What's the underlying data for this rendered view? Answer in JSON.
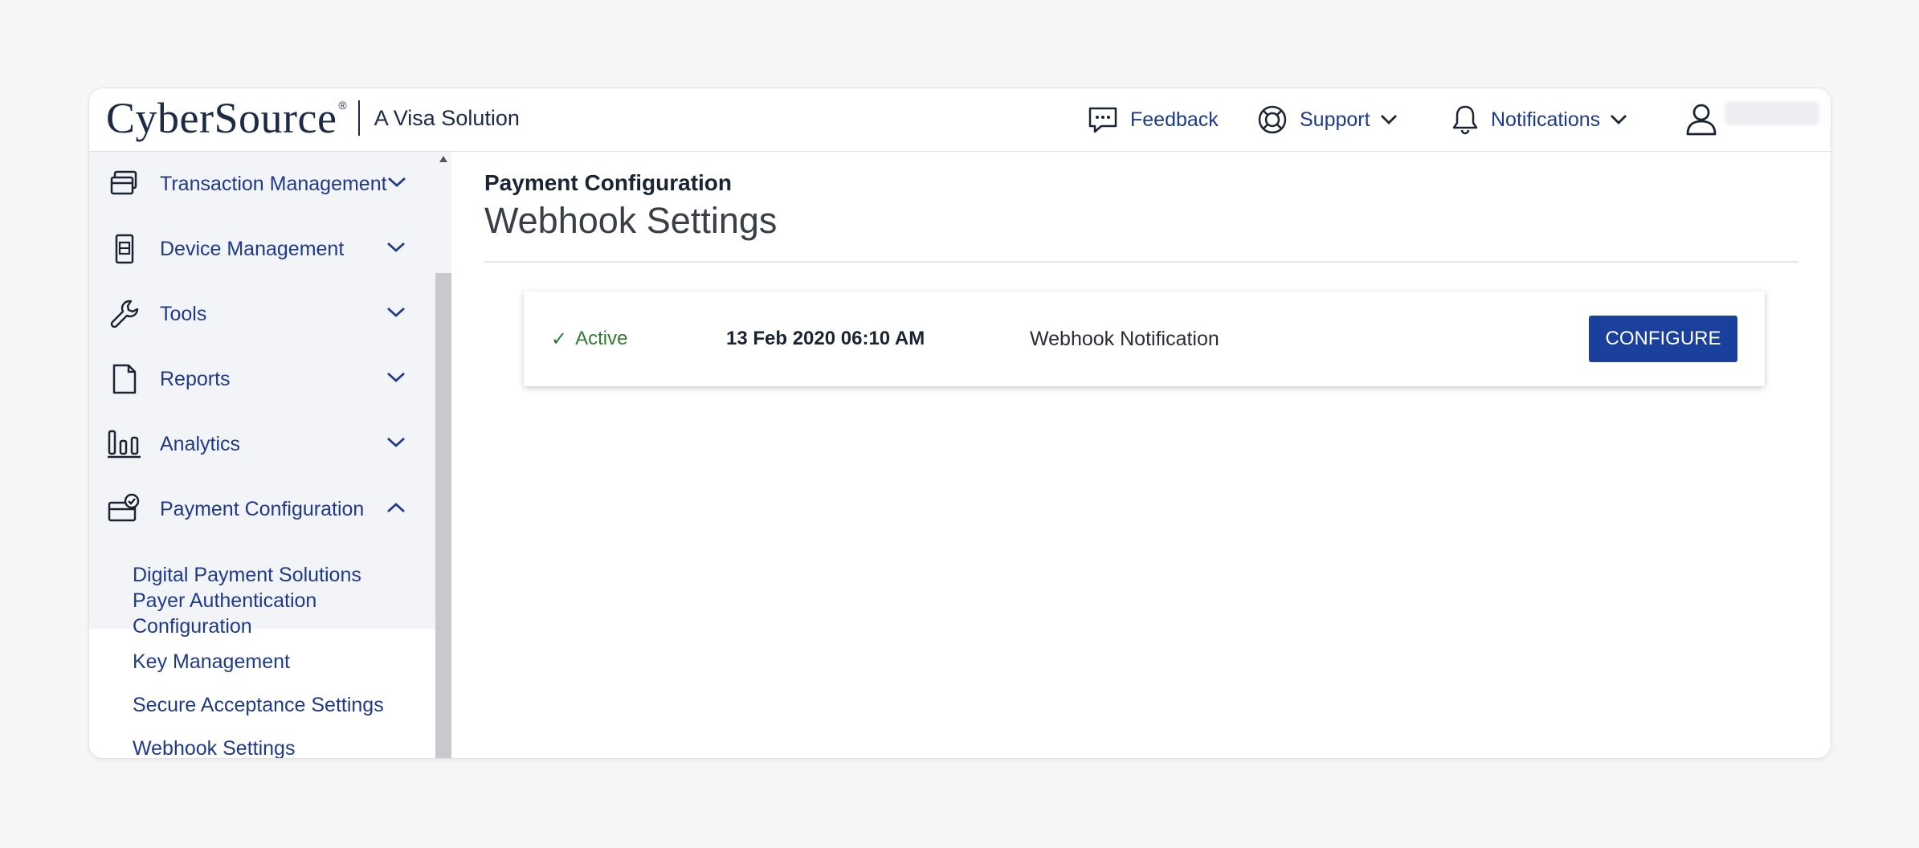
{
  "header": {
    "logo_text": "CyberSource",
    "logo_reg": "®",
    "logo_sub": "A Visa Solution",
    "feedback_label": "Feedback",
    "support_label": "Support",
    "notifications_label": "Notifications"
  },
  "sidebar": {
    "items": [
      {
        "label": "Transaction Management",
        "icon": "card-stack-icon",
        "expanded": false
      },
      {
        "label": "Device Management",
        "icon": "device-icon",
        "expanded": false
      },
      {
        "label": "Tools",
        "icon": "wrench-icon",
        "expanded": false
      },
      {
        "label": "Reports",
        "icon": "document-icon",
        "expanded": false
      },
      {
        "label": "Analytics",
        "icon": "bar-chart-icon",
        "expanded": false
      },
      {
        "label": "Payment Configuration",
        "icon": "card-check-icon",
        "expanded": true
      }
    ],
    "sub_items": [
      "Digital Payment Solutions",
      "Payer Authentication",
      "Configuration",
      "Key Management",
      "Secure Acceptance Settings",
      "Webhook Settings"
    ]
  },
  "main": {
    "breadcrumb": "Payment Configuration",
    "title": "Webhook Settings",
    "card": {
      "status_icon": "✓",
      "status": "Active",
      "date": "13 Feb 2020 06:10 AM",
      "name": "Webhook Notification",
      "button_label": "CONFIGURE"
    }
  },
  "colors": {
    "accent": "#1e3a8a",
    "button": "#1a3f9c",
    "status_active": "#2e7d32",
    "sidebar_bg": "#f3f4f8"
  }
}
